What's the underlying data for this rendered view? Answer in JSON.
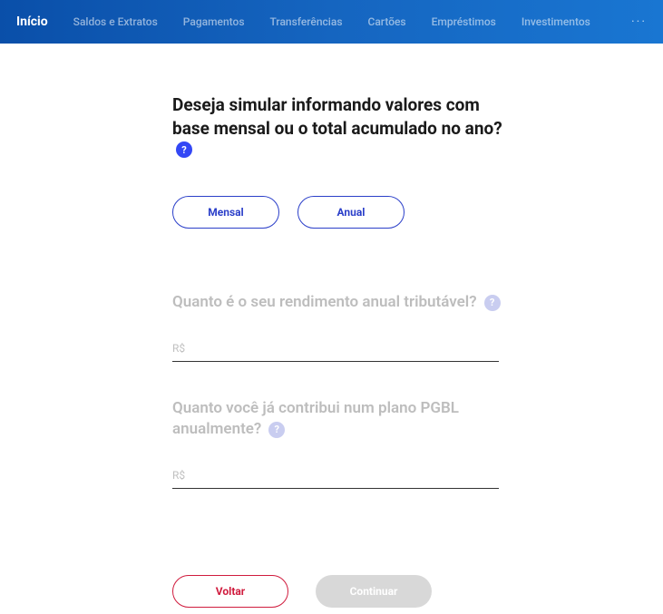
{
  "nav": {
    "items": [
      {
        "label": "Início",
        "active": true
      },
      {
        "label": "Saldos e Extratos",
        "active": false
      },
      {
        "label": "Pagamentos",
        "active": false
      },
      {
        "label": "Transferências",
        "active": false
      },
      {
        "label": "Cartões",
        "active": false
      },
      {
        "label": "Empréstimos",
        "active": false
      },
      {
        "label": "Investimentos",
        "active": false
      }
    ],
    "more": "···"
  },
  "question": {
    "title": "Deseja simular informando valores com base mensal ou o total acumulado no ano?",
    "help_symbol": "?"
  },
  "toggles": {
    "monthly": "Mensal",
    "annual": "Anual"
  },
  "fields": {
    "income": {
      "label": "Quanto é o seu rendimento anual tributável?",
      "placeholder": "R$",
      "value": "",
      "help_symbol": "?"
    },
    "pgbl": {
      "label": "Quanto você já contribui num plano PGBL anualmente?",
      "placeholder": "R$",
      "value": "",
      "help_symbol": "?"
    }
  },
  "actions": {
    "back": "Voltar",
    "continue": "Continuar"
  }
}
